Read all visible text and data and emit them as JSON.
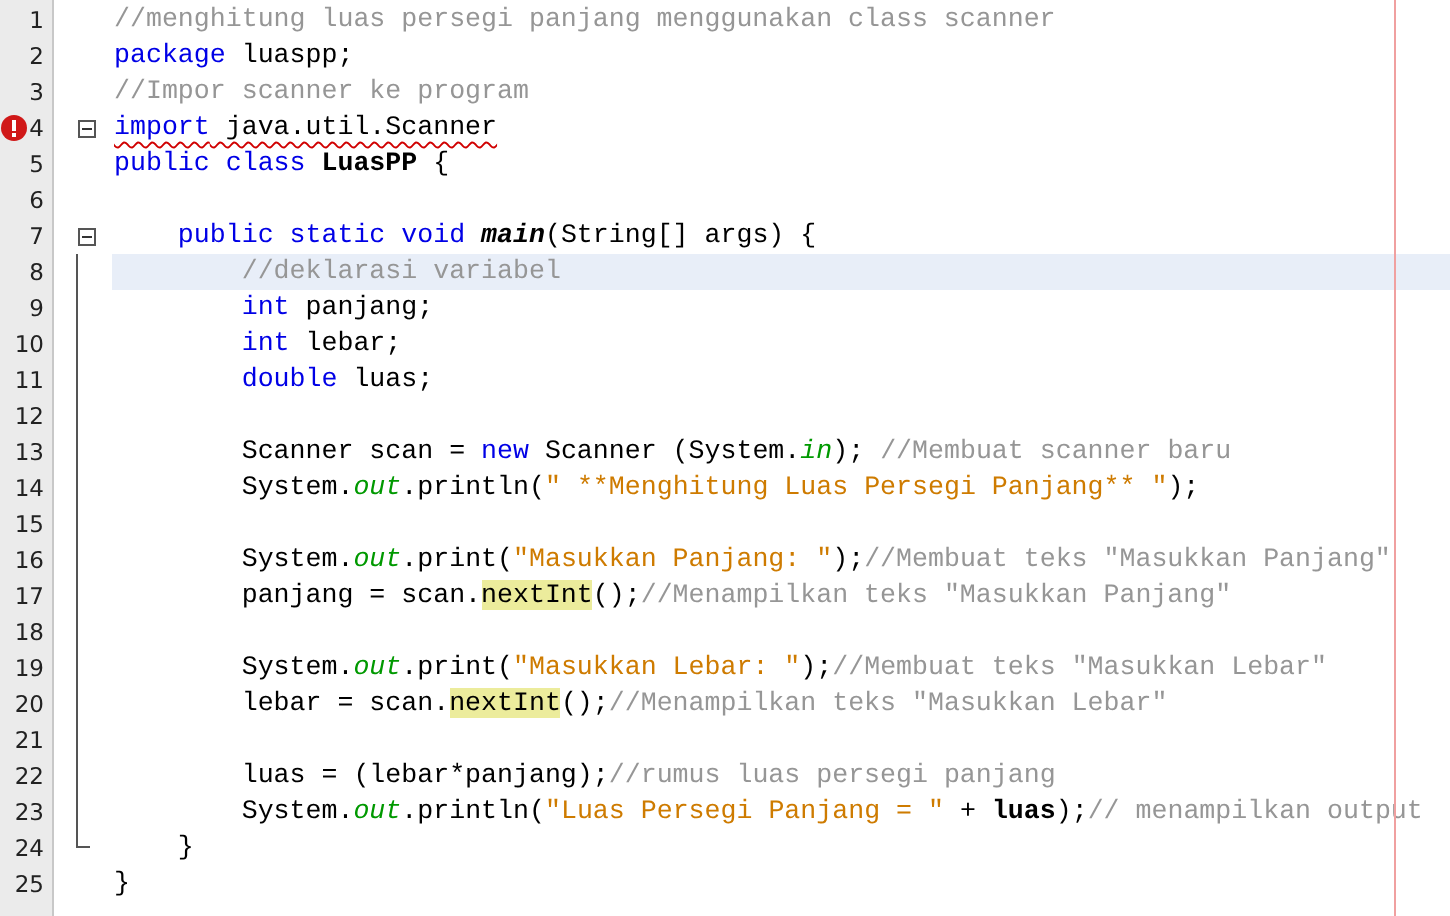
{
  "editor": {
    "lines": [
      {
        "number": "1",
        "current": false,
        "error": false,
        "tokens": [
          {
            "kind": "comment",
            "t": "//menghitung luas persegi panjang menggunakan class scanner"
          }
        ]
      },
      {
        "number": "2",
        "current": false,
        "error": false,
        "tokens": [
          {
            "kind": "kw",
            "t": "package"
          },
          {
            "kind": "text",
            "t": " luaspp;"
          }
        ]
      },
      {
        "number": "3",
        "current": false,
        "error": false,
        "tokens": [
          {
            "kind": "comment",
            "t": "//Impor scanner ke program"
          }
        ]
      },
      {
        "number": "4",
        "current": false,
        "error": true,
        "fold_start": true,
        "tokens": [
          {
            "kind": "kw",
            "t": "import"
          },
          {
            "kind": "text",
            "t": " java.util.Scanner"
          }
        ]
      },
      {
        "number": "5",
        "current": false,
        "error": false,
        "tokens": [
          {
            "kind": "kw",
            "t": "public class"
          },
          {
            "kind": "bold",
            "t": " LuasPP"
          },
          {
            "kind": "text",
            "t": " {"
          }
        ]
      },
      {
        "number": "6",
        "current": false,
        "error": false
      },
      {
        "number": "7",
        "current": false,
        "error": false,
        "fold_start": true,
        "tokens": [
          {
            "kind": "kw",
            "t": "    public static void"
          },
          {
            "kind": "decl",
            "t": " main"
          },
          {
            "kind": "text",
            "t": "(String[] args) {"
          }
        ]
      },
      {
        "number": "8",
        "current": true,
        "error": false,
        "fold_body": true,
        "tokens": [
          {
            "kind": "comment",
            "t": "        //deklarasi variabel"
          }
        ]
      },
      {
        "number": "9",
        "current": false,
        "error": false,
        "fold_body": true,
        "tokens": [
          {
            "kind": "kw",
            "t": "        int"
          },
          {
            "kind": "text",
            "t": " panjang;"
          }
        ]
      },
      {
        "number": "10",
        "current": false,
        "error": false,
        "fold_body": true,
        "tokens": [
          {
            "kind": "kw",
            "t": "        int"
          },
          {
            "kind": "text",
            "t": " lebar;"
          }
        ]
      },
      {
        "number": "11",
        "current": false,
        "error": false,
        "fold_body": true,
        "tokens": [
          {
            "kind": "kw",
            "t": "        double"
          },
          {
            "kind": "text",
            "t": " luas;"
          }
        ]
      },
      {
        "number": "12",
        "current": false,
        "error": false,
        "fold_body": true
      },
      {
        "number": "13",
        "current": false,
        "error": false,
        "fold_body": true,
        "tokens": [
          {
            "kind": "text",
            "t": "        Scanner scan = "
          },
          {
            "kind": "kw",
            "t": "new"
          },
          {
            "kind": "text",
            "t": " Scanner (System."
          },
          {
            "kind": "field",
            "t": "in"
          },
          {
            "kind": "text",
            "t": "); "
          },
          {
            "kind": "comment",
            "t": "//Membuat scanner baru"
          }
        ]
      },
      {
        "number": "14",
        "current": false,
        "error": false,
        "fold_body": true,
        "tokens": [
          {
            "kind": "text",
            "t": "        System."
          },
          {
            "kind": "field",
            "t": "out"
          },
          {
            "kind": "text",
            "t": ".println("
          },
          {
            "kind": "string",
            "t": "\" **Menghitung Luas Persegi Panjang** \""
          },
          {
            "kind": "text",
            "t": ");"
          }
        ]
      },
      {
        "number": "15",
        "current": false,
        "error": false,
        "fold_body": true
      },
      {
        "number": "16",
        "current": false,
        "error": false,
        "fold_body": true,
        "tokens": [
          {
            "kind": "text",
            "t": "        System."
          },
          {
            "kind": "field",
            "t": "out"
          },
          {
            "kind": "text",
            "t": ".print("
          },
          {
            "kind": "string",
            "t": "\"Masukkan Panjang: \""
          },
          {
            "kind": "text",
            "t": ");"
          },
          {
            "kind": "comment",
            "t": "//Membuat teks \"Masukkan Panjang\""
          }
        ]
      },
      {
        "number": "17",
        "current": false,
        "error": false,
        "fold_body": true,
        "tokens": [
          {
            "kind": "text",
            "t": "        panjang = scan."
          },
          {
            "kind": "mark",
            "t": "nextInt"
          },
          {
            "kind": "text",
            "t": "();"
          },
          {
            "kind": "comment",
            "t": "//Menampilkan teks \"Masukkan Panjang\""
          }
        ]
      },
      {
        "number": "18",
        "current": false,
        "error": false,
        "fold_body": true
      },
      {
        "number": "19",
        "current": false,
        "error": false,
        "fold_body": true,
        "tokens": [
          {
            "kind": "text",
            "t": "        System."
          },
          {
            "kind": "field",
            "t": "out"
          },
          {
            "kind": "text",
            "t": ".print("
          },
          {
            "kind": "string",
            "t": "\"Masukkan Lebar: \""
          },
          {
            "kind": "text",
            "t": ");"
          },
          {
            "kind": "comment",
            "t": "//Membuat teks \"Masukkan Lebar\""
          }
        ]
      },
      {
        "number": "20",
        "current": false,
        "error": false,
        "fold_body": true,
        "tokens": [
          {
            "kind": "text",
            "t": "        lebar = scan."
          },
          {
            "kind": "mark",
            "t": "nextInt"
          },
          {
            "kind": "text",
            "t": "();"
          },
          {
            "kind": "comment",
            "t": "//Menampilkan teks \"Masukkan Lebar\""
          }
        ]
      },
      {
        "number": "21",
        "current": false,
        "error": false,
        "fold_body": true
      },
      {
        "number": "22",
        "current": false,
        "error": false,
        "fold_body": true,
        "tokens": [
          {
            "kind": "text",
            "t": "        luas = (lebar*panjang);"
          },
          {
            "kind": "comment",
            "t": "//rumus luas persegi panjang"
          }
        ]
      },
      {
        "number": "23",
        "current": false,
        "error": false,
        "fold_body": true,
        "tokens": [
          {
            "kind": "text",
            "t": "        System."
          },
          {
            "kind": "field",
            "t": "out"
          },
          {
            "kind": "text",
            "t": ".println("
          },
          {
            "kind": "string",
            "t": "\"Luas Persegi Panjang = \""
          },
          {
            "kind": "text",
            "t": " + "
          },
          {
            "kind": "bold",
            "t": "luas"
          },
          {
            "kind": "text",
            "t": ");"
          },
          {
            "kind": "comment",
            "t": "// menampilkan output"
          }
        ]
      },
      {
        "number": "24",
        "current": false,
        "error": false,
        "fold_end": true,
        "tokens": [
          {
            "kind": "text",
            "t": "    }"
          }
        ]
      },
      {
        "number": "25",
        "current": false,
        "error": false,
        "tokens": [
          {
            "kind": "text",
            "t": "}"
          }
        ]
      }
    ]
  }
}
